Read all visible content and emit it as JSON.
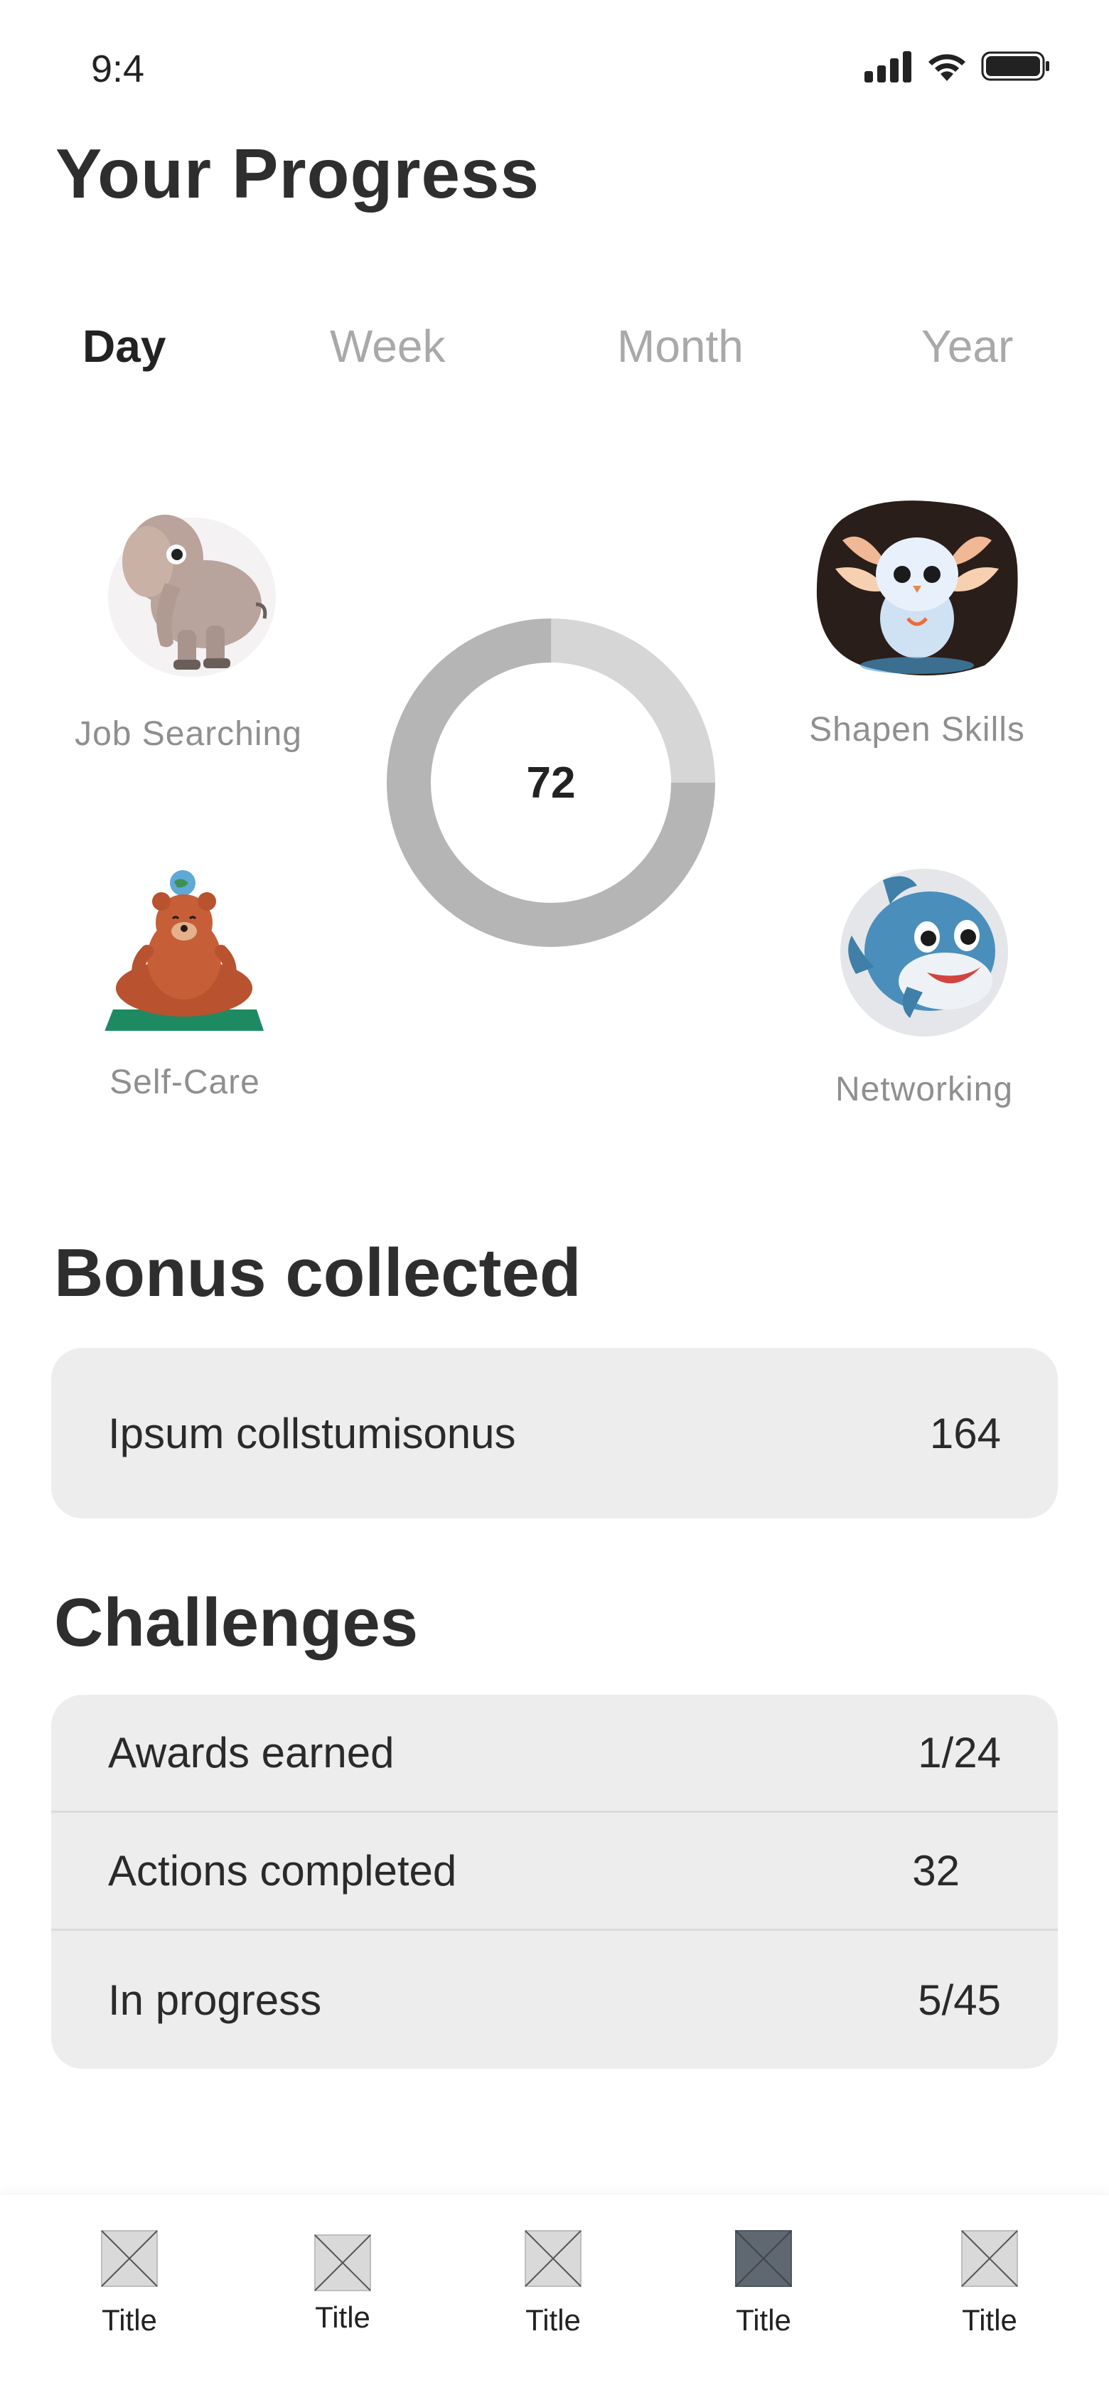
{
  "status_bar": {
    "time": "9:4",
    "icons": [
      "signal-icon",
      "wifi-icon",
      "battery-icon"
    ]
  },
  "page": {
    "title": "Your Progress"
  },
  "tabs": [
    {
      "label": "Day",
      "active": true
    },
    {
      "label": "Week",
      "active": false
    },
    {
      "label": "Month",
      "active": false
    },
    {
      "label": "Year",
      "active": false
    }
  ],
  "categories": [
    {
      "label": "Job Searching",
      "icon": "elephant-illustration"
    },
    {
      "label": "Shapen Skills",
      "icon": "glowing-owl-illustration"
    },
    {
      "label": "Self-Care",
      "icon": "meditating-bear-illustration"
    },
    {
      "label": "Networking",
      "icon": "dolphin-illustration"
    }
  ],
  "progress": {
    "value": "72",
    "ring_segments": [
      {
        "share": 0.75,
        "color": "#b5b5b5"
      },
      {
        "share": 0.25,
        "color": "#d6d6d6"
      }
    ]
  },
  "bonus": {
    "title": "Bonus collected",
    "rows": [
      {
        "label": "Ipsum collstumisonus",
        "value": "164"
      }
    ]
  },
  "challenges": {
    "title": "Challenges",
    "rows": [
      {
        "label": "Awards earned",
        "value": "1/24"
      },
      {
        "label": "Actions completed",
        "value": "32"
      },
      {
        "label": "In progress",
        "value": "5/45"
      }
    ]
  },
  "bottom_nav": [
    {
      "label": "Title",
      "icon": "placeholder-image-icon",
      "active": false
    },
    {
      "label": "Title",
      "icon": "placeholder-image-icon",
      "active": false
    },
    {
      "label": "Title",
      "icon": "placeholder-image-icon",
      "active": false
    },
    {
      "label": "Title",
      "icon": "placeholder-image-icon",
      "active": true
    },
    {
      "label": "Title",
      "icon": "placeholder-image-icon",
      "active": false
    }
  ],
  "colors": {
    "text_primary": "#2e2e2e",
    "text_muted": "#a9a9a9",
    "card_bg": "#ededee",
    "nav_active": "#5f6770",
    "nav_inactive": "#d9d9d9"
  }
}
